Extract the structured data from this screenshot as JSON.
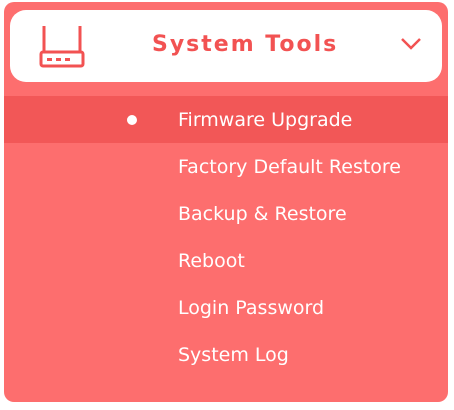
{
  "menu": {
    "header": {
      "icon": "router-icon",
      "title": "System Tools",
      "chevron_icon": "chevron-down-icon",
      "expanded": true
    },
    "items": [
      {
        "label": "Firmware Upgrade",
        "active": true
      },
      {
        "label": "Factory Default Restore",
        "active": false
      },
      {
        "label": "Backup & Restore",
        "active": false
      },
      {
        "label": "Reboot",
        "active": false
      },
      {
        "label": "Login Password",
        "active": false
      },
      {
        "label": "System Log",
        "active": false
      }
    ]
  },
  "colors": {
    "panel_background": "#fd6e6e",
    "active_item_background": "#f25757",
    "header_background": "#ffffff",
    "header_text": "#f25252",
    "item_text": "#ffffff"
  }
}
